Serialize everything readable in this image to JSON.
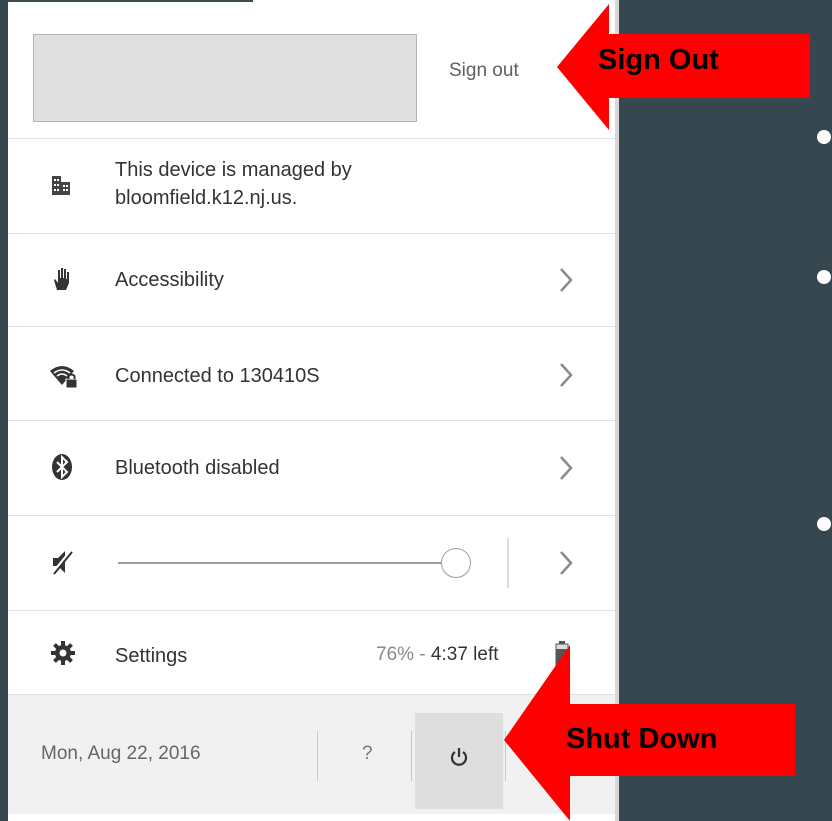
{
  "user_card": {
    "sign_out_label": "Sign out"
  },
  "managed_notice": {
    "line1": "This device is managed by",
    "line2": "bloomfield.k12.nj.us.",
    "icon": "building-icon"
  },
  "menu_rows": [
    {
      "label": "Accessibility",
      "icon": "hand-icon"
    },
    {
      "label": "Connected to 130410S",
      "icon": "wifi-locked-icon"
    },
    {
      "label": "Bluetooth disabled",
      "icon": "bluetooth-icon"
    }
  ],
  "volume": {
    "icon": "volume-muted-icon",
    "level": 1.0
  },
  "settings_row": {
    "label": "Settings",
    "icon": "gear-icon",
    "battery_percent": "76%",
    "battery_separator": " - ",
    "battery_time_left": "4:37 left",
    "battery_icon": "battery-icon"
  },
  "bottom_bar": {
    "date": "Mon, Aug 22, 2016",
    "help_label": "?",
    "power_icon": "power-icon"
  },
  "annotations": {
    "sign_out_callout": "Sign Out",
    "shut_down_callout": "Shut Down",
    "callout_color": "#ff0000"
  },
  "colors": {
    "background": "#36474f",
    "tray": "#ffffff",
    "bottom_bar": "#f1f1f1",
    "callout": "#ff0000"
  }
}
